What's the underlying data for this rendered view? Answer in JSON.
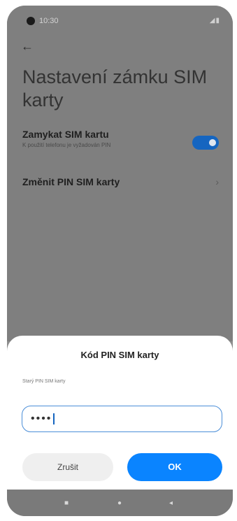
{
  "status_bar": {
    "time": "10:30",
    "indicators": "◢▮"
  },
  "header": {
    "back_icon": "←",
    "title": "Nastavení zámku SIM karty"
  },
  "settings": {
    "lock_sim": {
      "label": "Zamykat SIM kartu",
      "sublabel": "K použití telefonu je vyžadován PIN",
      "enabled": true
    },
    "change_pin": {
      "label": "Změnit PIN SIM karty",
      "chevron": "›"
    }
  },
  "dialog": {
    "title": "Kód PIN SIM karty",
    "field_label": "Starý PIN SIM karty",
    "pin_value": "••••",
    "cancel_label": "Zrušit",
    "ok_label": "OK"
  },
  "nav_bar": {
    "recent_icon": "■",
    "home_icon": "●",
    "back_icon": "◂"
  },
  "colors": {
    "accent": "#0a84ff",
    "toggle": "#1565c0",
    "input_border": "#4b8ed8"
  }
}
